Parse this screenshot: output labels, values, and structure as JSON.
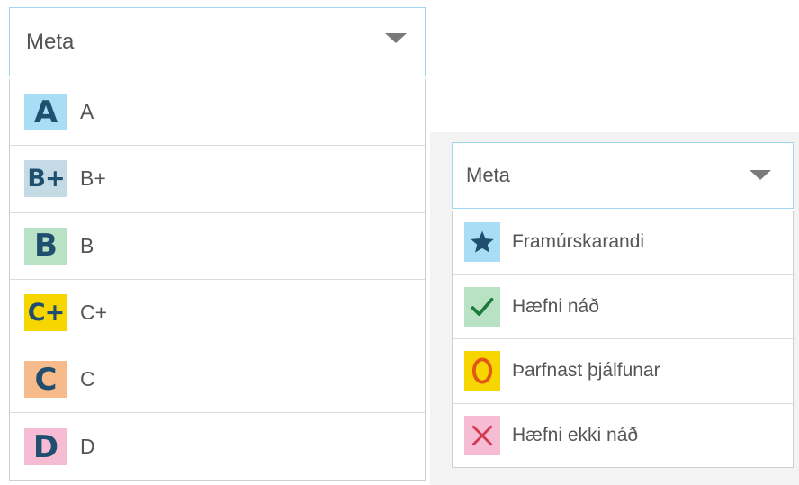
{
  "letter_grade_dropdown": {
    "placeholder": "Meta",
    "options": [
      {
        "badge": "A",
        "label": "A",
        "color": "#a9dcf5"
      },
      {
        "badge": "B+",
        "label": "B+",
        "color": "#c4dbe6"
      },
      {
        "badge": "B",
        "label": "B",
        "color": "#b9e2c5"
      },
      {
        "badge": "C+",
        "label": "C+",
        "color": "#f7d600"
      },
      {
        "badge": "C",
        "label": "C",
        "color": "#f7ba8a"
      },
      {
        "badge": "D",
        "label": "D",
        "color": "#f6bcd3"
      }
    ]
  },
  "competency_dropdown": {
    "placeholder": "Meta",
    "options": [
      {
        "icon": "star-icon",
        "label": "Framúrskarandi",
        "color": "#a9dcf5",
        "icon_color": "#1f4e6e"
      },
      {
        "icon": "checkmark-icon",
        "label": "Hæfni náð",
        "color": "#b9e2c5",
        "icon_color": "#1c7a3a"
      },
      {
        "icon": "circle-o-icon",
        "label": "Þarfnast þjálfunar",
        "color": "#f7d600",
        "icon_color": "#e2561a"
      },
      {
        "icon": "cross-icon",
        "label": "Hæfni ekki náð",
        "color": "#f6bcd3",
        "icon_color": "#d33a4e"
      }
    ]
  }
}
